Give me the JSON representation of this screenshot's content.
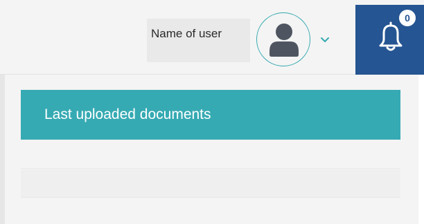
{
  "header": {
    "user_name": "Name of user",
    "notifications": {
      "count": "0"
    }
  },
  "panel": {
    "title": "Last uploaded documents",
    "rows": [
      "",
      "",
      ""
    ]
  },
  "colors": {
    "accent_teal": "#36aab3",
    "notification_blue": "#255592"
  }
}
